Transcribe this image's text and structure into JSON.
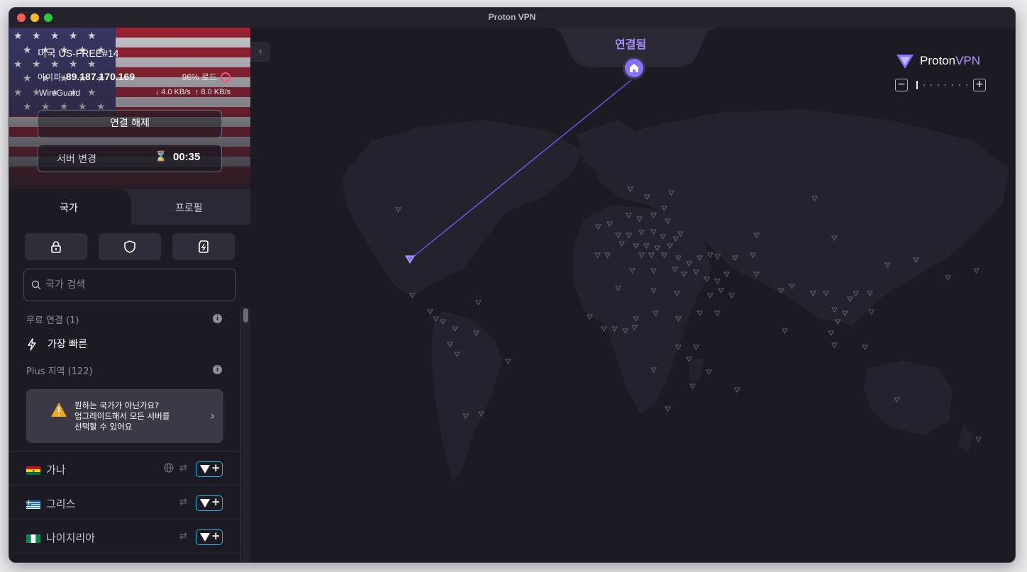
{
  "window": {
    "title": "Proton VPN"
  },
  "connection": {
    "server_name": "미국 US-FREE#14",
    "ip_label": "아이피:",
    "ip_value": "89.187.170.169",
    "load": "96% 로드",
    "protocol": "WireGuard",
    "download": "4.0 KB/s",
    "upload": "8.0 KB/s",
    "disconnect_label": "연결 해제",
    "change_server_label": "서버 변경",
    "change_server_timer": "00:35"
  },
  "tabs": {
    "countries": "국가",
    "profiles": "프로필"
  },
  "filters": [
    "lock-icon",
    "shield-icon",
    "sim-card-icon"
  ],
  "search": {
    "placeholder": "국가 검색"
  },
  "sections": {
    "free_header": "무료 연결 (1)",
    "fastest_label": "가장 빠른",
    "plus_header": "Plus 지역 (122)"
  },
  "upsell": {
    "line1": "원하는 국가가 아닌가요?",
    "line2": "업그레이드해서 모든 서버를",
    "line3": "선택할 수 있어요"
  },
  "countries": [
    {
      "name": "가나",
      "flag": "ghana"
    },
    {
      "name": "그리스",
      "flag": "greece"
    },
    {
      "name": "나이지리아",
      "flag": "nigeria"
    }
  ],
  "map": {
    "status_label": "연결됨",
    "brand_a": "Proton",
    "brand_b": "VPN",
    "zoom_out": "−",
    "zoom_in": "+"
  },
  "colors": {
    "accent": "#8b6fff",
    "status_connected": "#a98cff",
    "load_ring": "#ff4f6d",
    "plus_border": "#2fb5e6",
    "background": "#1c1b24"
  }
}
